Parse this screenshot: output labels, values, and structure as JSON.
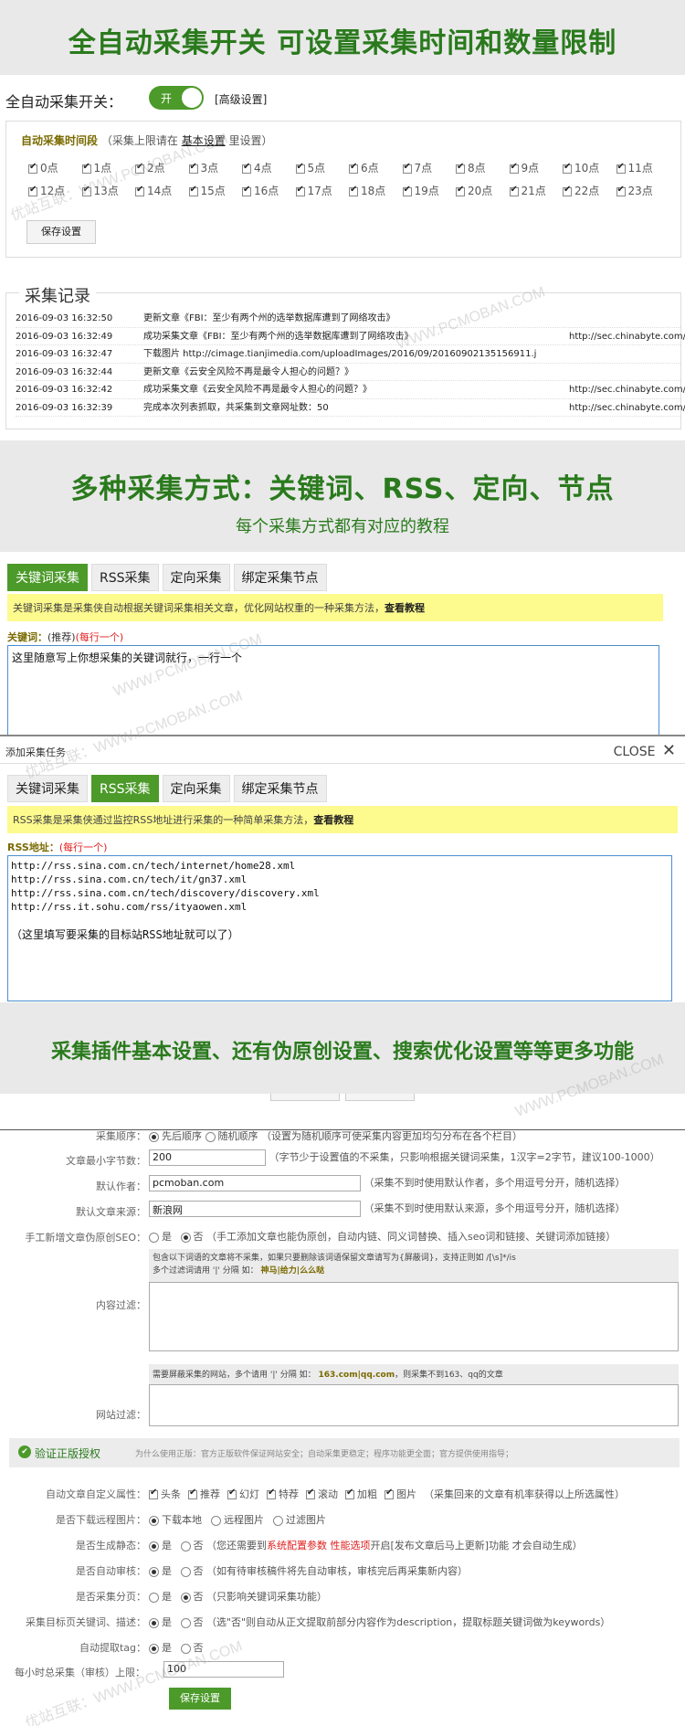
{
  "banner1": {
    "title": "全自动采集开关 可设置采集时间和数量限制"
  },
  "auto": {
    "label": "全自动采集开关：",
    "toggle_label": "开",
    "advanced": "[高级设置]",
    "period_title": "自动采集时间段",
    "period_note_pre": "（采集上限请在",
    "period_note_link": "基本设置",
    "period_note_post": "里设置）",
    "hours_row1": [
      "0点",
      "1点",
      "2点",
      "3点",
      "4点",
      "5点",
      "6点",
      "7点",
      "8点",
      "9点",
      "10点",
      "11点"
    ],
    "hours_row2": [
      "12点",
      "13点",
      "14点",
      "15点",
      "16点",
      "17点",
      "18点",
      "19点",
      "20点",
      "21点",
      "22点",
      "23点"
    ],
    "save": "保存设置"
  },
  "log": {
    "title": "采集记录",
    "rows": [
      {
        "time": "2016-09-03 16:32:50",
        "text": "更新文章《FBI：至少有两个州的选举数据库遭到了网络攻击》",
        "url": ""
      },
      {
        "time": "2016-09-03 16:32:49",
        "text": "成功采集文章《FBI：至少有两个州的选举数据库遭到了网络攻击》",
        "url": "http://sec.chinabyte.com/"
      },
      {
        "time": "2016-09-03 16:32:47",
        "text": "下载图片 http://cimage.tianjimedia.com/uploadImages/2016/09/20160902135156911.j",
        "url": ""
      },
      {
        "time": "2016-09-03 16:32:44",
        "text": "更新文章《云安全风险不再是最令人担心的问题？》",
        "url": ""
      },
      {
        "time": "2016-09-03 16:32:42",
        "text": "成功采集文章《云安全风险不再是最令人担心的问题？》",
        "url": "http://sec.chinabyte.com/"
      },
      {
        "time": "2016-09-03 16:32:39",
        "text": "完成本次列表抓取，共采集到文章网址数：50",
        "url": "http://sec.chinabyte.com/"
      }
    ]
  },
  "banner2": {
    "title": "多种采集方式：关键词、RSS、定向、节点",
    "subtitle": "每个采集方式都有对应的教程"
  },
  "tabs": [
    "关键词采集",
    "RSS采集",
    "定向采集",
    "绑定采集节点"
  ],
  "keyword": {
    "notice": "关键词采集是采集侠自动根据关键词采集相关文章，优化网站权重的一种采集方法，",
    "notice_link": "查看教程",
    "label": "关键词：",
    "label_note": "(推荐)",
    "label_req": "(每行一个)",
    "text": "这里随意写上你想采集的关键词就行，一行一个"
  },
  "dialog": {
    "title": "添加采集任务",
    "close": "CLOSE"
  },
  "rss": {
    "notice": "RSS采集是采集侠通过监控RSS地址进行采集的一种简单采集方法，",
    "notice_link": "查看教程",
    "label": "RSS地址：",
    "label_req": "(每行一个)",
    "lines": [
      "http://rss.sina.com.cn/tech/internet/home28.xml",
      "http://rss.sina.com.cn/tech/it/gn37.xml",
      "http://rss.sina.com.cn/tech/discovery/discovery.xml",
      "http://rss.it.sohu.com/rss/ityaowen.xml"
    ],
    "hint": "（这里填写要采集的目标站RSS地址就可以了）"
  },
  "banner3": {
    "title": "采集插件基本设置、还有伪原创设置、搜索优化设置等等更多功能"
  },
  "settings": {
    "order_label": "采集顺序：",
    "order_opt1": "先后顺序",
    "order_opt2": "随机顺序",
    "order_note": "（设置为随机顺序可使采集内容更加均匀分布在各个栏目）",
    "minlen_label": "文章最小字节数：",
    "minlen_value": "200",
    "minlen_note": "（字节少于设置值的不采集，只影响根据关键词采集，1汉字=2字节，建议100-1000）",
    "author_label": "默认作者：",
    "author_value": "pcmoban.com",
    "author_note": "（采集不到时使用默认作者，多个用逗号分开，随机选择）",
    "source_label": "默认文章来源：",
    "source_value": "新浪网",
    "source_note": "（采集不到时使用默认来源，多个用逗号分开，随机选择）",
    "manual_label": "手工新增文章伪原创SEO：",
    "yes": "是",
    "no": "否",
    "manual_note": "（手工添加文章也能伪原创，自动内链、同义词替换、插入seo词和链接、关键词添加链接）",
    "filter_label": "内容过滤：",
    "filter_tip1": "包含以下词语的文章将不采集，如果只要删除该词语保留文章请写为{屏蔽词}，支持正则如 /[\\s]*/is",
    "filter_tip2": "多个过滤词请用",
    "filter_tip2b": "'|'",
    "filter_tip2c": "分隔 如：",
    "filter_tip2d": "神马|给力|么么哒",
    "site_label": "网站过滤：",
    "site_tip1": "需要屏蔽采集的网站，多个请用",
    "site_tip1b": "'|'",
    "site_tip1c": "分隔 如：",
    "site_tip1d": "163.com|qq.com",
    "site_tip1e": "，则采集不到163、qq的文章",
    "auth_title": "验证正版授权",
    "auth_note": "为什么使用正版：官方正版软件保证网站安全；自动采集更稳定；程序功能更全面；官方提供使用指导；",
    "attr_label": "自动文章自定义属性：",
    "attrs": [
      "头条",
      "推荐",
      "幻灯",
      "特荐",
      "滚动",
      "加粗",
      "图片"
    ],
    "attr_note": "（采集回来的文章有机率获得以上所选属性）",
    "remote_label": "是否下载远程图片：",
    "remote_opts": [
      "下载本地",
      "远程图片",
      "过滤图片"
    ],
    "static_label": "是否生成静态：",
    "static_note_pre": "（您还需要到",
    "static_note_red": "系统配置参数 性能选项",
    "static_note_post": "开启[发布文章后马上更新]功能 才会自动生成）",
    "audit_label": "是否自动审核：",
    "audit_note": "（如有待审核稿件将先自动审核，审核完后再采集新内容）",
    "paging_label": "是否采集分页：",
    "paging_note": "（只影响关键词采集功能）",
    "desc_label": "采集目标页关键词、描述：",
    "desc_note": "（选\"否\"则自动从正文提取前部分内容作为description，提取标题关键词做为keywords）",
    "tag_label": "自动提取tag：",
    "limit_label": "每小时总采集（审核）上限：",
    "limit_value": "100",
    "save": "保存设置"
  },
  "watermarks": [
    "优站互联：WWW.PCMOBAN.COM",
    "WWW.PCMOBAN.COM"
  ]
}
